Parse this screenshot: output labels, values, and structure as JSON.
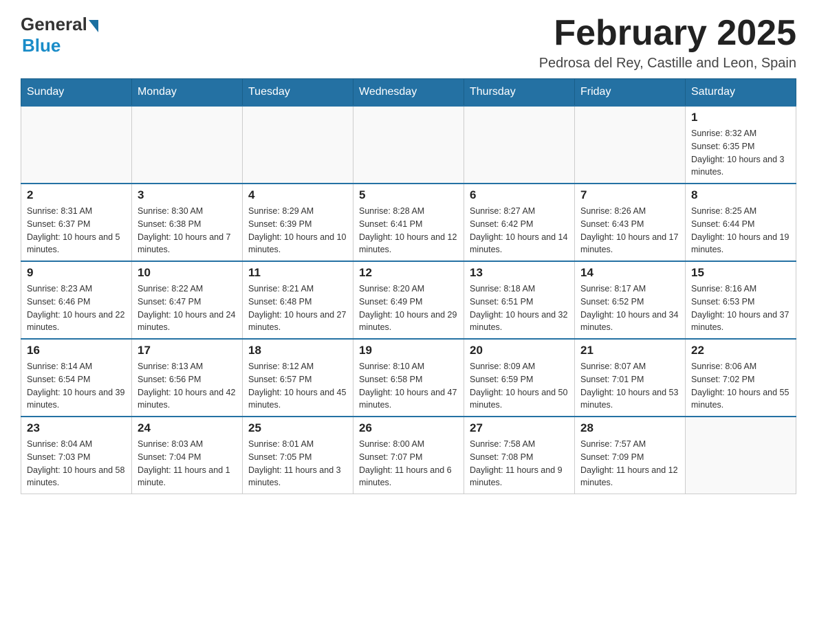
{
  "header": {
    "logo": {
      "general": "General",
      "blue": "Blue"
    },
    "title": "February 2025",
    "location": "Pedrosa del Rey, Castille and Leon, Spain"
  },
  "days_of_week": [
    "Sunday",
    "Monday",
    "Tuesday",
    "Wednesday",
    "Thursday",
    "Friday",
    "Saturday"
  ],
  "weeks": [
    [
      {
        "day": "",
        "info": ""
      },
      {
        "day": "",
        "info": ""
      },
      {
        "day": "",
        "info": ""
      },
      {
        "day": "",
        "info": ""
      },
      {
        "day": "",
        "info": ""
      },
      {
        "day": "",
        "info": ""
      },
      {
        "day": "1",
        "info": "Sunrise: 8:32 AM\nSunset: 6:35 PM\nDaylight: 10 hours and 3 minutes."
      }
    ],
    [
      {
        "day": "2",
        "info": "Sunrise: 8:31 AM\nSunset: 6:37 PM\nDaylight: 10 hours and 5 minutes."
      },
      {
        "day": "3",
        "info": "Sunrise: 8:30 AM\nSunset: 6:38 PM\nDaylight: 10 hours and 7 minutes."
      },
      {
        "day": "4",
        "info": "Sunrise: 8:29 AM\nSunset: 6:39 PM\nDaylight: 10 hours and 10 minutes."
      },
      {
        "day": "5",
        "info": "Sunrise: 8:28 AM\nSunset: 6:41 PM\nDaylight: 10 hours and 12 minutes."
      },
      {
        "day": "6",
        "info": "Sunrise: 8:27 AM\nSunset: 6:42 PM\nDaylight: 10 hours and 14 minutes."
      },
      {
        "day": "7",
        "info": "Sunrise: 8:26 AM\nSunset: 6:43 PM\nDaylight: 10 hours and 17 minutes."
      },
      {
        "day": "8",
        "info": "Sunrise: 8:25 AM\nSunset: 6:44 PM\nDaylight: 10 hours and 19 minutes."
      }
    ],
    [
      {
        "day": "9",
        "info": "Sunrise: 8:23 AM\nSunset: 6:46 PM\nDaylight: 10 hours and 22 minutes."
      },
      {
        "day": "10",
        "info": "Sunrise: 8:22 AM\nSunset: 6:47 PM\nDaylight: 10 hours and 24 minutes."
      },
      {
        "day": "11",
        "info": "Sunrise: 8:21 AM\nSunset: 6:48 PM\nDaylight: 10 hours and 27 minutes."
      },
      {
        "day": "12",
        "info": "Sunrise: 8:20 AM\nSunset: 6:49 PM\nDaylight: 10 hours and 29 minutes."
      },
      {
        "day": "13",
        "info": "Sunrise: 8:18 AM\nSunset: 6:51 PM\nDaylight: 10 hours and 32 minutes."
      },
      {
        "day": "14",
        "info": "Sunrise: 8:17 AM\nSunset: 6:52 PM\nDaylight: 10 hours and 34 minutes."
      },
      {
        "day": "15",
        "info": "Sunrise: 8:16 AM\nSunset: 6:53 PM\nDaylight: 10 hours and 37 minutes."
      }
    ],
    [
      {
        "day": "16",
        "info": "Sunrise: 8:14 AM\nSunset: 6:54 PM\nDaylight: 10 hours and 39 minutes."
      },
      {
        "day": "17",
        "info": "Sunrise: 8:13 AM\nSunset: 6:56 PM\nDaylight: 10 hours and 42 minutes."
      },
      {
        "day": "18",
        "info": "Sunrise: 8:12 AM\nSunset: 6:57 PM\nDaylight: 10 hours and 45 minutes."
      },
      {
        "day": "19",
        "info": "Sunrise: 8:10 AM\nSunset: 6:58 PM\nDaylight: 10 hours and 47 minutes."
      },
      {
        "day": "20",
        "info": "Sunrise: 8:09 AM\nSunset: 6:59 PM\nDaylight: 10 hours and 50 minutes."
      },
      {
        "day": "21",
        "info": "Sunrise: 8:07 AM\nSunset: 7:01 PM\nDaylight: 10 hours and 53 minutes."
      },
      {
        "day": "22",
        "info": "Sunrise: 8:06 AM\nSunset: 7:02 PM\nDaylight: 10 hours and 55 minutes."
      }
    ],
    [
      {
        "day": "23",
        "info": "Sunrise: 8:04 AM\nSunset: 7:03 PM\nDaylight: 10 hours and 58 minutes."
      },
      {
        "day": "24",
        "info": "Sunrise: 8:03 AM\nSunset: 7:04 PM\nDaylight: 11 hours and 1 minute."
      },
      {
        "day": "25",
        "info": "Sunrise: 8:01 AM\nSunset: 7:05 PM\nDaylight: 11 hours and 3 minutes."
      },
      {
        "day": "26",
        "info": "Sunrise: 8:00 AM\nSunset: 7:07 PM\nDaylight: 11 hours and 6 minutes."
      },
      {
        "day": "27",
        "info": "Sunrise: 7:58 AM\nSunset: 7:08 PM\nDaylight: 11 hours and 9 minutes."
      },
      {
        "day": "28",
        "info": "Sunrise: 7:57 AM\nSunset: 7:09 PM\nDaylight: 11 hours and 12 minutes."
      },
      {
        "day": "",
        "info": ""
      }
    ]
  ]
}
